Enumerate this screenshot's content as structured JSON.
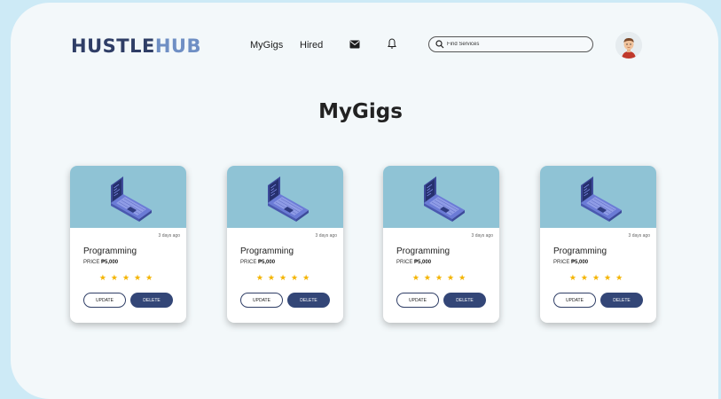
{
  "brand": {
    "part1": "HUSTLE",
    "part2": "HUB"
  },
  "nav": {
    "mygigs": "MyGigs",
    "hired": "Hired"
  },
  "search": {
    "placeholder": "Find Services"
  },
  "page": {
    "title": "MyGigs"
  },
  "cards": [
    {
      "title": "Programming",
      "date": "3 days ago",
      "price_label": "PRICE",
      "price": "₱5,000",
      "stars": "★★★★★",
      "update": "UPDATE",
      "delete": "DELETE"
    },
    {
      "title": "Programming",
      "date": "3 days ago",
      "price_label": "PRICE",
      "price": "₱5,000",
      "stars": "★★★★★",
      "update": "UPDATE",
      "delete": "DELETE"
    },
    {
      "title": "Programming",
      "date": "3 days ago",
      "price_label": "PRICE",
      "price": "₱5,000",
      "stars": "★★★★★",
      "update": "UPDATE",
      "delete": "DELETE"
    },
    {
      "title": "Programming",
      "date": "3 days ago",
      "price_label": "PRICE",
      "price": "₱5,000",
      "stars": "★★★★★",
      "update": "UPDATE",
      "delete": "DELETE"
    }
  ],
  "icons": [
    "mail-icon",
    "bell-icon",
    "search-icon",
    "avatar-icon",
    "laptop-icon"
  ],
  "colors": {
    "brand_dark": "#2f3e66",
    "brand_light": "#6f8fc4",
    "accent": "#334677",
    "card_image_bg": "#8fc3d5",
    "star": "#f4b400"
  }
}
